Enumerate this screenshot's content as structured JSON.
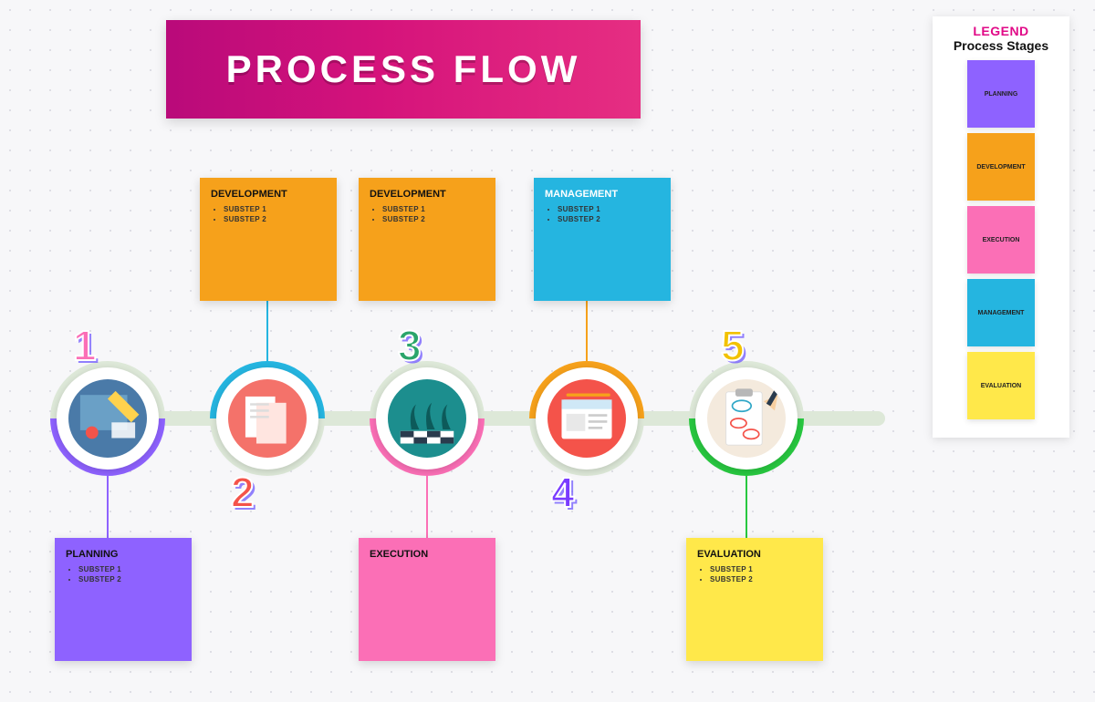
{
  "title": "PROCESS FLOW",
  "legend": {
    "title": "LEGEND",
    "subtitle": "Process Stages",
    "items": [
      {
        "label": "PLANNING",
        "color": "#8e62ff"
      },
      {
        "label": "DEVELOPMENT",
        "color": "#f6a11b"
      },
      {
        "label": "EXECUTION",
        "color": "#fb6fb6"
      },
      {
        "label": "MANAGEMENT",
        "color": "#25b5e0"
      },
      {
        "label": "EVALUATION",
        "color": "#ffe84a"
      }
    ]
  },
  "steps": [
    {
      "number": "1",
      "number_color": "#fb6fb6",
      "ring_top": "#dde8d8",
      "ring_bottom": "#8e62ff",
      "icon": "planning",
      "card": {
        "position": "below",
        "color": "#8e62ff",
        "title": "PLANNING",
        "substeps": [
          "SUBSTEP 1",
          "SUBSTEP 2"
        ],
        "connector_color": "#8e62ff"
      }
    },
    {
      "number": "2",
      "number_color": "#f4534a",
      "ring_top": "#25b5e0",
      "ring_bottom": "#dde8d8",
      "icon": "document",
      "card": {
        "position": "above",
        "color": "#f6a11b",
        "title": "DEVELOPMENT",
        "substeps": [
          "SUBSTEP 1",
          "SUBSTEP 2"
        ],
        "connector_color": "#25b5e0"
      },
      "card2": {
        "position": "above",
        "color": "#f6a11b",
        "title": "DEVELOPMENT",
        "substeps": [
          "SUBSTEP 1",
          "SUBSTEP 2"
        ]
      }
    },
    {
      "number": "3",
      "number_color": "#2aa56a",
      "ring_top": "#dde8d8",
      "ring_bottom": "#fb6fb6",
      "icon": "chess",
      "card": {
        "position": "below",
        "color": "#fb6fb6",
        "title": "EXECUTION",
        "substeps": [],
        "connector_color": "#fb6fb6"
      }
    },
    {
      "number": "4",
      "number_color": "#7a3cff",
      "ring_top": "#f6a11b",
      "ring_bottom": "#dde8d8",
      "icon": "browser",
      "card": {
        "position": "above",
        "color": "#25b5e0",
        "title": "MANAGEMENT",
        "substeps": [
          "SUBSTEP 1",
          "SUBSTEP 2"
        ],
        "connector_color": "#f6a11b"
      }
    },
    {
      "number": "5",
      "number_color": "#f2c200",
      "ring_top": "#dde8d8",
      "ring_bottom": "#28c840",
      "icon": "clipboard",
      "card": {
        "position": "below",
        "color": "#ffe84a",
        "title": "EVALUATION",
        "substeps": [
          "SUBSTEP 1",
          "SUBSTEP 2"
        ],
        "connector_color": "#28c840"
      }
    }
  ]
}
